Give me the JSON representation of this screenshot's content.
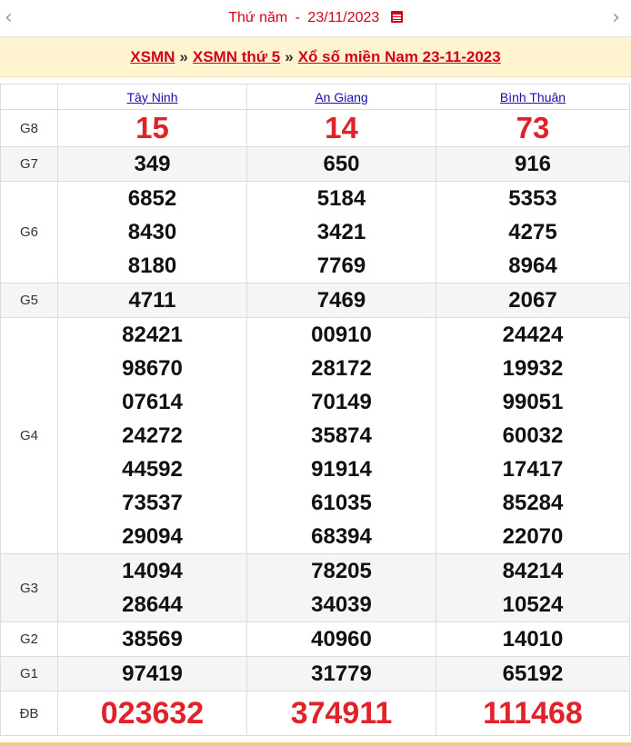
{
  "header": {
    "prev_icon": "chevron-left-icon",
    "next_icon": "chevron-right-icon",
    "day": "Thứ năm",
    "separator": "-",
    "date": "23/11/2023",
    "calendar_icon": "calendar-icon"
  },
  "breadcrumb": {
    "items": [
      "XSMN",
      "XSMN thứ 5",
      "Xổ số miền Nam 23-11-2023"
    ],
    "separator": "»"
  },
  "provinces": [
    "Tây Ninh",
    "An Giang",
    "Bình Thuận"
  ],
  "prizes": [
    {
      "label": "G8",
      "values": [
        [
          "15"
        ],
        [
          "14"
        ],
        [
          "73"
        ]
      ]
    },
    {
      "label": "G7",
      "values": [
        [
          "349"
        ],
        [
          "650"
        ],
        [
          "916"
        ]
      ]
    },
    {
      "label": "G6",
      "values": [
        [
          "6852",
          "8430",
          "8180"
        ],
        [
          "5184",
          "3421",
          "7769"
        ],
        [
          "5353",
          "4275",
          "8964"
        ]
      ]
    },
    {
      "label": "G5",
      "values": [
        [
          "4711"
        ],
        [
          "7469"
        ],
        [
          "2067"
        ]
      ]
    },
    {
      "label": "G4",
      "values": [
        [
          "82421",
          "98670",
          "07614",
          "24272",
          "44592",
          "73537",
          "29094"
        ],
        [
          "00910",
          "28172",
          "70149",
          "35874",
          "91914",
          "61035",
          "68394"
        ],
        [
          "24424",
          "19932",
          "99051",
          "60032",
          "17417",
          "85284",
          "22070"
        ]
      ]
    },
    {
      "label": "G3",
      "values": [
        [
          "14094",
          "28644"
        ],
        [
          "78205",
          "34039"
        ],
        [
          "84214",
          "10524"
        ]
      ]
    },
    {
      "label": "G2",
      "values": [
        [
          "38569"
        ],
        [
          "40960"
        ],
        [
          "14010"
        ]
      ]
    },
    {
      "label": "G1",
      "values": [
        [
          "97419"
        ],
        [
          "31779"
        ],
        [
          "65192"
        ]
      ]
    },
    {
      "label": "ĐB",
      "values": [
        [
          "023632"
        ],
        [
          "374911"
        ],
        [
          "111468"
        ]
      ]
    }
  ],
  "colors": {
    "accent": "#d0011b",
    "highlight_number": "#e0222b",
    "link": "#1a0dab",
    "breadcrumb_bg": "#fff4cf"
  }
}
